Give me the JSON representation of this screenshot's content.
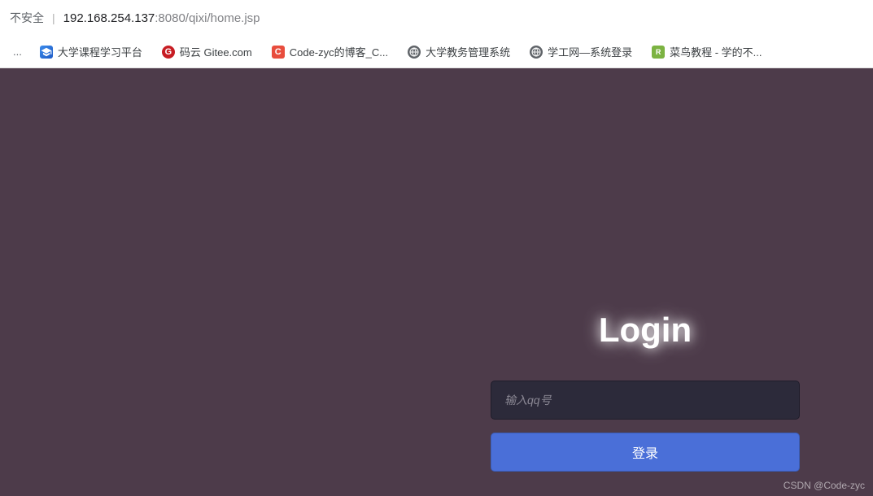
{
  "address_bar": {
    "security_label": "不安全",
    "separator": "|",
    "url_host": "192.168.254.137",
    "url_rest": ":8080/qixi/home.jsp"
  },
  "bookmarks": {
    "ellipsis": "...",
    "items": [
      {
        "label": "大学课程学习平台",
        "icon_key": "grad"
      },
      {
        "label": "码云 Gitee.com",
        "icon_key": "gitee",
        "icon_text": "G"
      },
      {
        "label": "Code-zyc的博客_C...",
        "icon_key": "c",
        "icon_text": "C"
      },
      {
        "label": "大学教务管理系统",
        "icon_key": "globe"
      },
      {
        "label": "学工网—系统登录",
        "icon_key": "globe"
      },
      {
        "label": "菜鸟教程 - 学的不...",
        "icon_key": "runoob",
        "icon_text": "R"
      }
    ]
  },
  "login": {
    "title": "Login",
    "input_placeholder": "输入qq号",
    "button_label": "登录"
  },
  "watermark": "CSDN @Code-zyc"
}
